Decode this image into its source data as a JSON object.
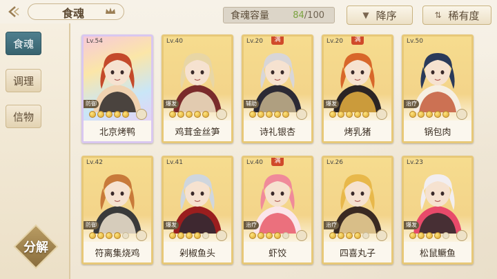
{
  "header": {
    "title": "食魂",
    "capacity_label": "食魂容量",
    "capacity_current": "84",
    "capacity_max": "/100",
    "sort_order_label": "降序",
    "sort_by_label": "稀有度"
  },
  "sidebar": {
    "tabs": [
      {
        "label": "食魂",
        "active": true
      },
      {
        "label": "调理",
        "active": false
      },
      {
        "label": "信物",
        "active": false
      }
    ],
    "decompose_label": "分解"
  },
  "colors": {
    "accent_teal": "#3f6f7c",
    "gold": "#e7c878",
    "capacity_green": "#7aa23f"
  },
  "cards": [
    {
      "level": "Lv.54",
      "name": "北京烤鸭",
      "role": "防御",
      "stars": 5,
      "full": false,
      "rainbow": true,
      "palette": [
        "#c44a2a",
        "#f0d2b0",
        "#2d2a2a"
      ]
    },
    {
      "level": "Lv.40",
      "name": "鸡茸金丝笋",
      "role": "爆发",
      "stars": 5,
      "full": false,
      "rainbow": false,
      "palette": [
        "#e8d6a5",
        "#7a2b2b",
        "#f4e8c8"
      ]
    },
    {
      "level": "Lv.20",
      "name": "诗礼银杏",
      "role": "辅助",
      "stars": 5,
      "full": true,
      "rainbow": false,
      "palette": [
        "#d8d6d8",
        "#2c2a34",
        "#c7b48e"
      ]
    },
    {
      "level": "Lv.20",
      "name": "烤乳猪",
      "role": "爆发",
      "stars": 5,
      "full": true,
      "rainbow": false,
      "palette": [
        "#d8672a",
        "#2b2424",
        "#e8b040"
      ]
    },
    {
      "level": "Lv.50",
      "name": "锅包肉",
      "role": "治疗",
      "stars": 5,
      "full": false,
      "rainbow": false,
      "palette": [
        "#2a3a5a",
        "#f6efe2",
        "#c45a3a"
      ]
    },
    {
      "level": "Lv.42",
      "name": "符离集烧鸡",
      "role": "防御",
      "stars": 4,
      "full": false,
      "rainbow": false,
      "palette": [
        "#c87a3a",
        "#3a3a3a",
        "#f2e6d2"
      ]
    },
    {
      "level": "Lv.41",
      "name": "剁椒鱼头",
      "role": "爆发",
      "stars": 4,
      "full": false,
      "rainbow": false,
      "palette": [
        "#cfd6de",
        "#9a1e1e",
        "#2e2a34"
      ]
    },
    {
      "level": "Lv.40",
      "name": "虾饺",
      "role": "治疗",
      "stars": 4,
      "full": true,
      "rainbow": false,
      "palette": [
        "#f08a9a",
        "#fbe6ea",
        "#e85a6a"
      ]
    },
    {
      "level": "Lv.26",
      "name": "四喜丸子",
      "role": "治疗",
      "stars": 4,
      "full": false,
      "rainbow": false,
      "palette": [
        "#e8b84a",
        "#3a2a22",
        "#f4d89a"
      ]
    },
    {
      "level": "Lv.23",
      "name": "松鼠鳜鱼",
      "role": "爆发",
      "stars": 4,
      "full": false,
      "rainbow": false,
      "palette": [
        "#f2eef0",
        "#e84a6a",
        "#2a2a2a"
      ]
    }
  ]
}
